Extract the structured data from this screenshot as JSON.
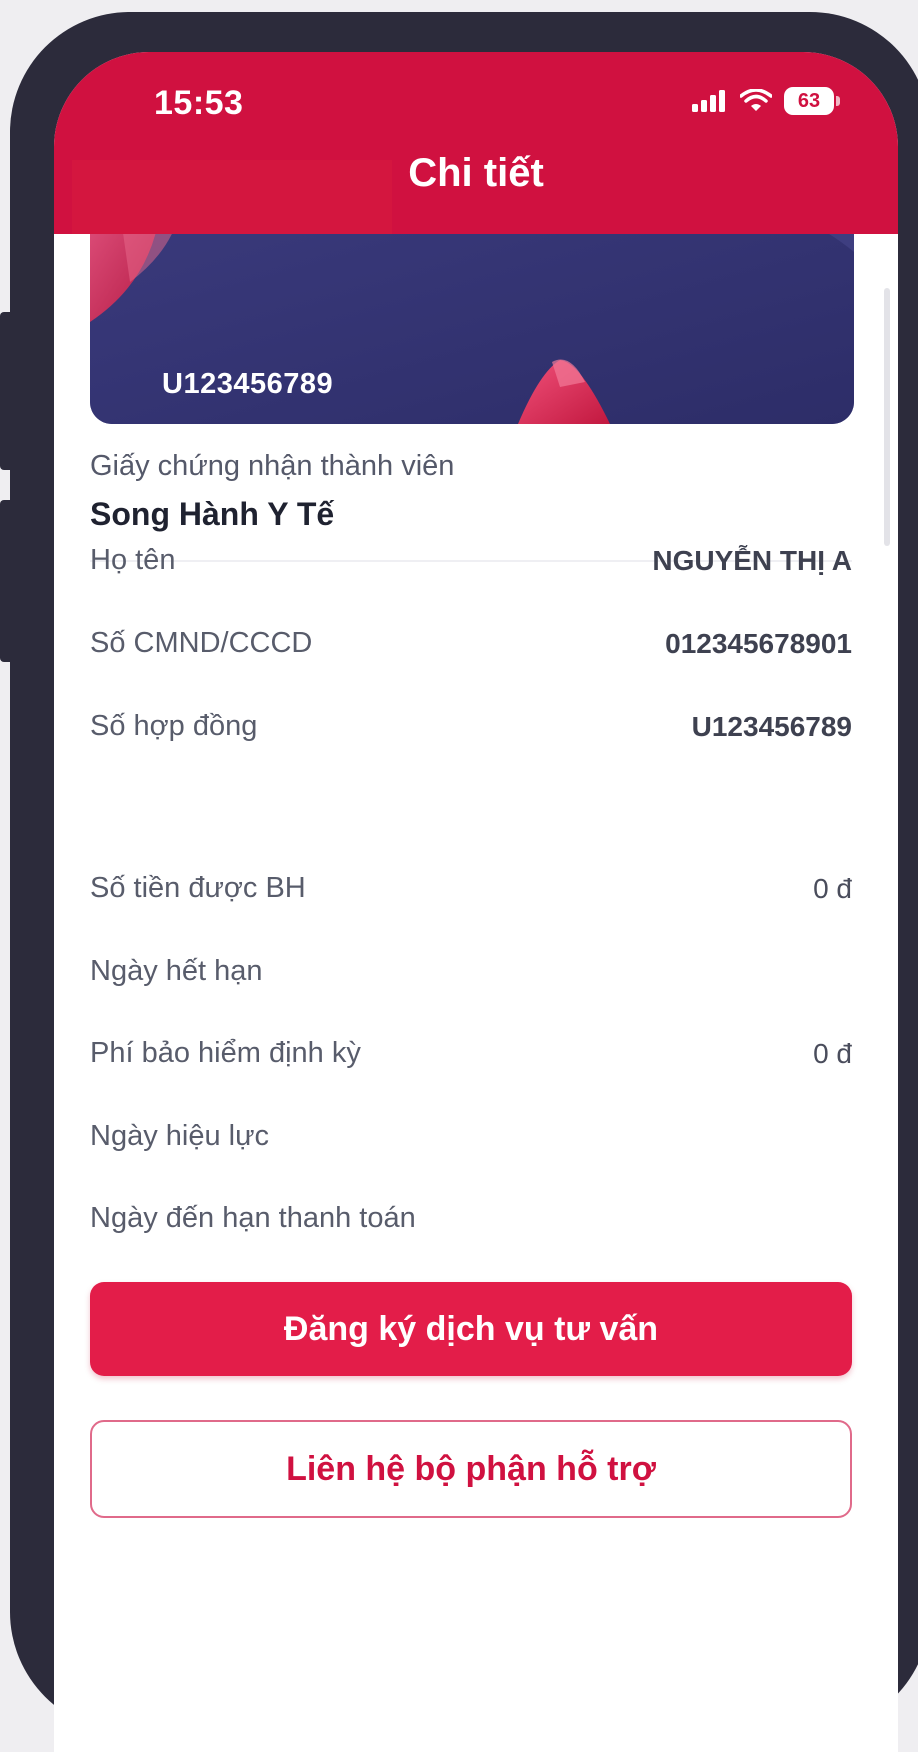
{
  "status_bar": {
    "time": "15:53",
    "battery": "63"
  },
  "header": {
    "title": "Chi tiết"
  },
  "card": {
    "number": "U123456789"
  },
  "certificate": {
    "label": "Giấy chứng nhận thành viên",
    "name": "Song Hành Y Tế"
  },
  "details": [
    {
      "label": "Họ tên",
      "value": "NGUYỄN THỊ A"
    },
    {
      "label": "Số CMND/CCCD",
      "value": "012345678901"
    },
    {
      "label": "Số hợp đồng",
      "value": "U123456789"
    },
    {
      "label": "Số tiền được BH",
      "value": "0 đ"
    },
    {
      "label": "Ngày hết hạn",
      "value": ""
    },
    {
      "label": "Phí bảo hiểm định kỳ",
      "value": "0 đ"
    },
    {
      "label": "Ngày hiệu lực",
      "value": ""
    },
    {
      "label": "Ngày đến hạn thanh toán",
      "value": ""
    }
  ],
  "buttons": {
    "register": "Đăng ký dịch vụ tư vấn",
    "contact": "Liên hệ bộ phận hỗ trợ"
  },
  "colors": {
    "brand": "#d01140",
    "primary_button": "#e31d49",
    "frame": "#2c2b3b"
  }
}
